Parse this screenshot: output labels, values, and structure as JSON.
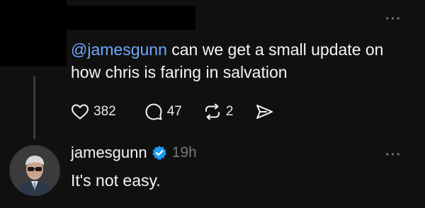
{
  "post": {
    "mention": "@jamesgunn",
    "text": " can we get a small update on how chris is faring in salvation",
    "likes": "382",
    "comments": "47",
    "reposts": "2"
  },
  "reply": {
    "username": "jamesgunn",
    "time": "19h",
    "text": "It's not easy."
  },
  "colors": {
    "background": "#101010",
    "mention": "#6fa8ff",
    "verified": "#1d9bf0",
    "muted": "#777777"
  },
  "icons": [
    "heart-icon",
    "comment-icon",
    "repost-icon",
    "share-icon",
    "verified-badge-icon",
    "more-icon"
  ]
}
